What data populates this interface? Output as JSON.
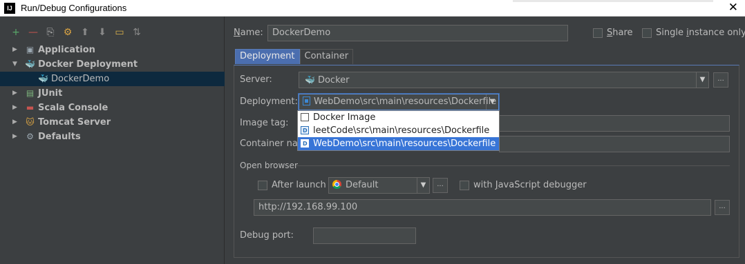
{
  "window": {
    "title": "Run/Debug Configurations",
    "app_icon_text": "IJ",
    "close_glyph": "✕"
  },
  "toolbar": {
    "items": [
      {
        "icon": "add-icon",
        "glyph": "+",
        "color": "#59a869"
      },
      {
        "icon": "remove-icon",
        "glyph": "—",
        "color": "#c75450"
      },
      {
        "icon": "copy-icon",
        "glyph": "⎘",
        "color": "#aaaaaa"
      },
      {
        "icon": "settings-icon",
        "glyph": "⚙",
        "color": "#d9a343"
      },
      {
        "icon": "move-up-icon",
        "glyph": "⬆",
        "color": "#888888"
      },
      {
        "icon": "move-down-icon",
        "glyph": "⬇",
        "color": "#888888"
      },
      {
        "icon": "folder-icon",
        "glyph": "▭",
        "color": "#d9b04a"
      },
      {
        "icon": "sort-icon",
        "glyph": "⇅",
        "color": "#888888"
      }
    ]
  },
  "tree": [
    {
      "label": "Application",
      "expanded": false,
      "icon": "application-icon"
    },
    {
      "label": "Docker Deployment",
      "expanded": true,
      "icon": "docker-icon"
    },
    {
      "label": "DockerDemo",
      "child": true,
      "selected": true,
      "icon": "docker-icon"
    },
    {
      "label": "JUnit",
      "expanded": false,
      "icon": "junit-icon"
    },
    {
      "label": "Scala Console",
      "expanded": false,
      "icon": "scala-icon"
    },
    {
      "label": "Tomcat Server",
      "expanded": false,
      "icon": "tomcat-icon"
    },
    {
      "label": "Defaults",
      "expanded": false,
      "icon": "defaults-icon"
    }
  ],
  "form": {
    "name_label_u": "N",
    "name_label_rest": "ame:",
    "name_value": "DockerDemo",
    "share_label_u": "S",
    "share_label_rest": "hare",
    "single_instance_label_pre": "Single ",
    "single_instance_label_u": "i",
    "single_instance_label_post": "nstance only"
  },
  "tabs": [
    {
      "label": "Deployment",
      "active": true
    },
    {
      "label": "Container",
      "active": false
    }
  ],
  "deployment": {
    "server_label": "Server:",
    "server_value": "Docker",
    "deployment_label": "Deployment:",
    "deployment_value": "WebDemo\\src\\main\\resources\\Dockerfile",
    "image_tag_label": "Image tag:",
    "container_name_label": "Container nam",
    "ellipsis": "...",
    "dropdown_arrow": "▼",
    "options": [
      {
        "label": "Docker Image",
        "kind": "image",
        "selected": false
      },
      {
        "label": "leetCode\\src\\main\\resources\\Dockerfile",
        "kind": "file",
        "selected": false
      },
      {
        "label": "WebDemo\\src\\main\\resources\\Dockerfile",
        "kind": "file",
        "selected": true
      }
    ]
  },
  "browser": {
    "section_label": "Open browser",
    "after_launch_label": "After launch",
    "browser_value": "Default",
    "js_debugger_label_pre": "with ",
    "js_debugger_label_u": "J",
    "js_debugger_label_post": "avaScript debugger",
    "url": "http://192.168.99.100"
  },
  "debug": {
    "port_label": "Debug port:",
    "port_value": ""
  },
  "colors": {
    "selection": "#0d293e",
    "tab_active": "#4b6eaf",
    "popup_selected": "#3875d7",
    "background": "#3c3f41"
  }
}
